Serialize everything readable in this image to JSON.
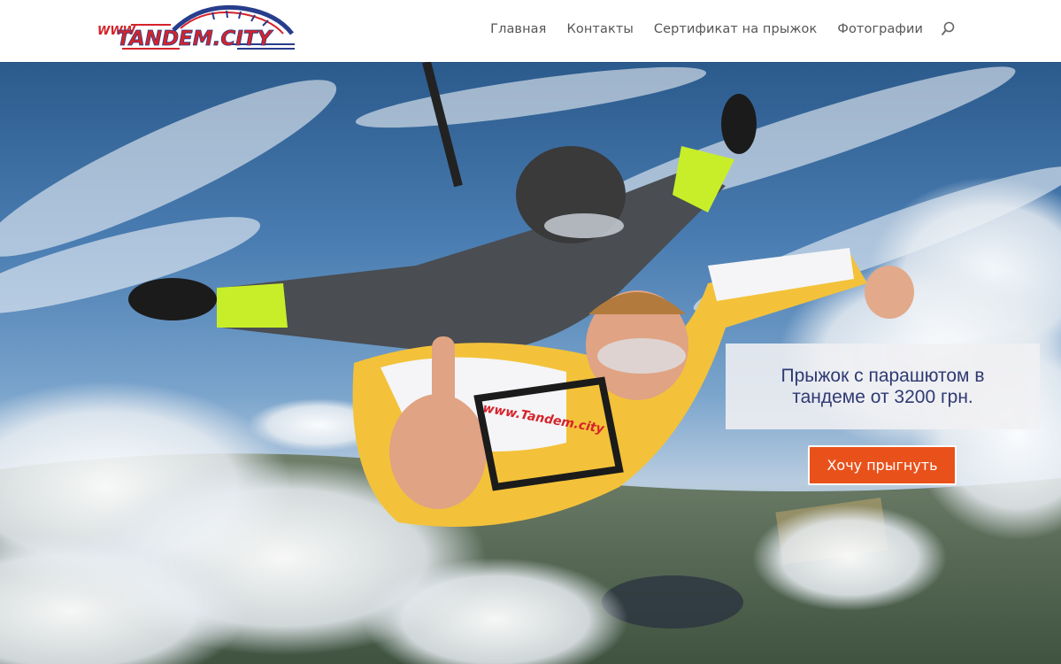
{
  "header": {
    "logo": {
      "prefix": "WWW.",
      "name": "TANDEM.CITY"
    },
    "nav": [
      {
        "label": "Главная"
      },
      {
        "label": "Контакты"
      },
      {
        "label": "Сертификат на прыжок"
      },
      {
        "label": "Фотографии"
      }
    ],
    "search_icon": "search-icon"
  },
  "hero": {
    "promo_text": "Прыжок с парашютом в тандеме от 3200 грн.",
    "cta_label": "Хочу прыгнуть",
    "suit_print": "www.Tandem.city"
  },
  "colors": {
    "accent": "#e9511b",
    "promo_text": "#2f3a73",
    "logo_red": "#d5232a",
    "logo_blue": "#283d8c"
  }
}
